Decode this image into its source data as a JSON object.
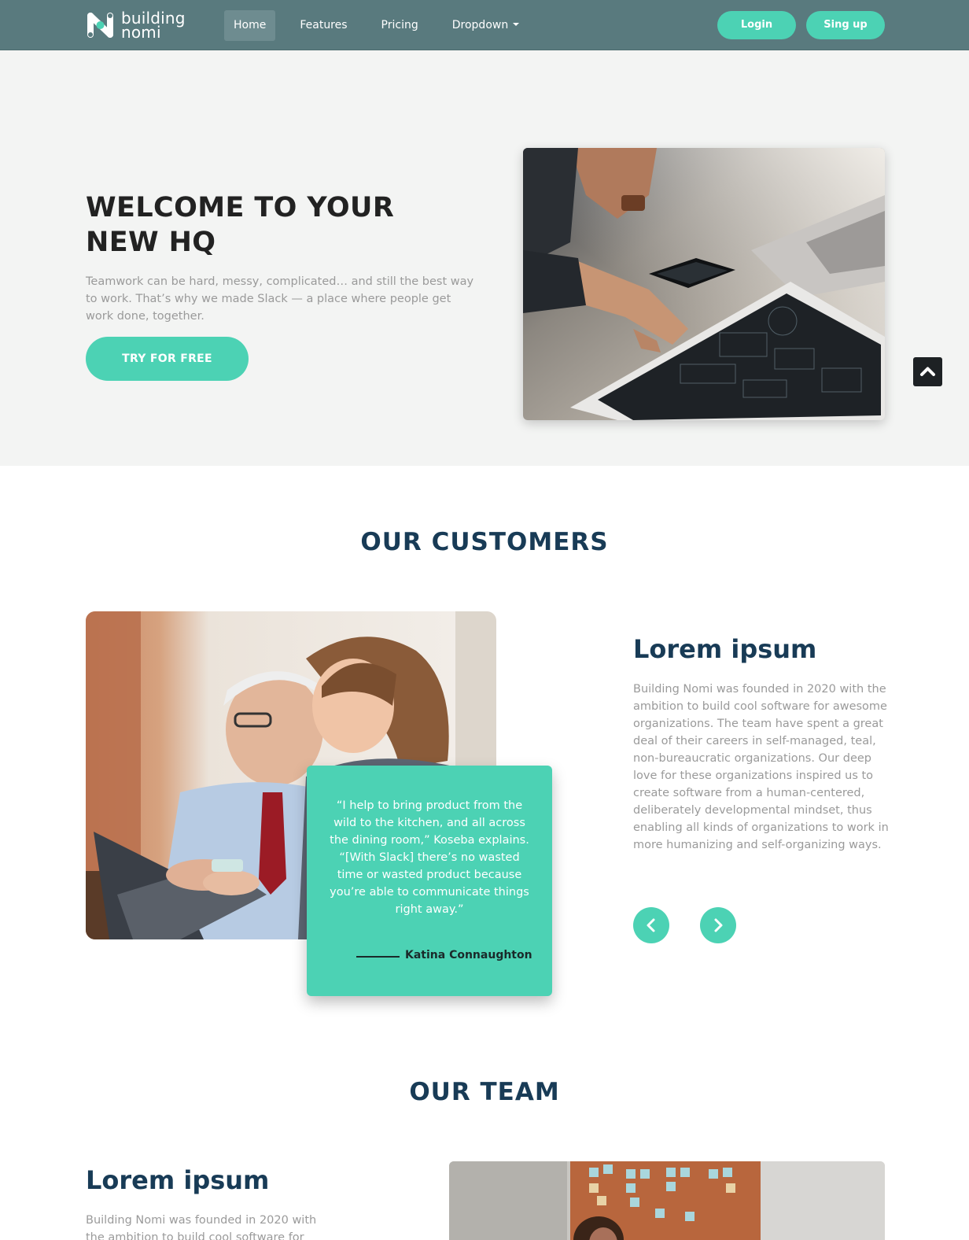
{
  "navbar": {
    "brand_top": "building",
    "brand_bottom": "nomi",
    "links": [
      "Home",
      "Features",
      "Pricing",
      "Dropdown"
    ],
    "login": "Login",
    "signup": "Sing up",
    "accent": "#4cd2b4",
    "bg": "#597a7e"
  },
  "hero": {
    "title_line1": "WELCOME TO YOUR",
    "title_line2": "NEW HQ",
    "text": "Teamwork can be hard, messy, complicated… and still the best way to work. That’s why we made Slack — a place where people get work done, together.",
    "cta": "TRY FOR FREE"
  },
  "customers": {
    "title": "OUR CUSTOMERS",
    "quote": "“I help to bring product from the wild to the kitchen, and all across the dining room,” Koseba explains. “[With Slack] there’s no wasted time or wasted product because you’re able to communicate things right away.”",
    "author": "Katina Connaughton",
    "heading": "Lorem ipsum",
    "body": "Building Nomi was founded in 2020 with the ambition to build cool software for awesome organizations. The team have spent a great deal of their careers in self-managed, teal, non-bureaucratic organizations. Our deep love for these organizations inspired us to create software from a human-centered, deliberately developmental mindset, thus enabling all kinds of organizations to work in more humanizing and self-organizing ways."
  },
  "team": {
    "title": "OUR TEAM",
    "heading": "Lorem ipsum",
    "body": "Building Nomi was founded in 2020 with the ambition to build cool software for"
  },
  "icons": {
    "scroll_top": "chevron-up-icon",
    "prev": "chevron-left-icon",
    "next": "chevron-right-icon",
    "dropdown": "caret-down-icon"
  }
}
